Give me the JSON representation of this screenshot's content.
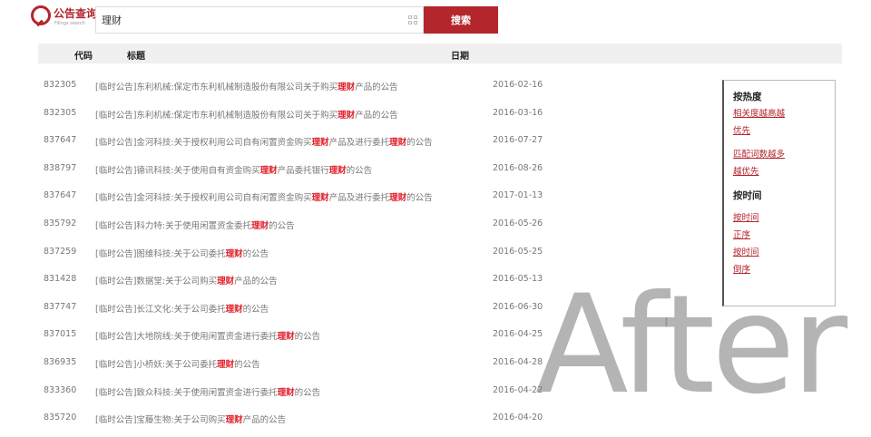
{
  "logo": {
    "text": "公告查询",
    "sub": "Filings search"
  },
  "search": {
    "value": "理财",
    "button_label": "搜索"
  },
  "table": {
    "headers": {
      "code": "代码",
      "title": "标题",
      "date": "日期"
    },
    "rows": [
      {
        "code": "832305",
        "pre": "[临时公告]东利机械:保定市东利机械制造股份有限公司关于购买",
        "hl1": "理财",
        "mid": "产品的公告",
        "hl2": "",
        "post": "",
        "date": "2016-02-16"
      },
      {
        "code": "832305",
        "pre": "[临时公告]东利机械:保定市东利机械制造股份有限公司关于购买",
        "hl1": "理财",
        "mid": "产品的公告",
        "hl2": "",
        "post": "",
        "date": "2016-03-16"
      },
      {
        "code": "837647",
        "pre": "[临时公告]金河科技:关于授权利用公司自有闲置资金购买",
        "hl1": "理财",
        "mid": "产品及进行委托",
        "hl2": "理财",
        "post": "的公告",
        "date": "2016-07-27"
      },
      {
        "code": "838797",
        "pre": "[临时公告]德讯科技:关于使用自有资金购买",
        "hl1": "理财",
        "mid": "产品委托银行",
        "hl2": "理财",
        "post": "的公告",
        "date": "2016-08-26"
      },
      {
        "code": "837647",
        "pre": "[临时公告]金河科技:关于授权利用公司自有闲置资金购买",
        "hl1": "理财",
        "mid": "产品及进行委托",
        "hl2": "理财",
        "post": "的公告",
        "date": "2017-01-13"
      },
      {
        "code": "835792",
        "pre": "[临时公告]科力特:关于使用闲置资金委托",
        "hl1": "理财",
        "mid": "的公告",
        "hl2": "",
        "post": "",
        "date": "2016-05-26"
      },
      {
        "code": "837259",
        "pre": "[临时公告]图维科技:关于公司委托",
        "hl1": "理财",
        "mid": "的公告",
        "hl2": "",
        "post": "",
        "date": "2016-05-25"
      },
      {
        "code": "831428",
        "pre": "[临时公告]数据堂:关于公司购买",
        "hl1": "理财",
        "mid": "产品的公告",
        "hl2": "",
        "post": "",
        "date": "2016-05-13"
      },
      {
        "code": "837747",
        "pre": "[临时公告]长江文化:关于公司委托",
        "hl1": "理财",
        "mid": "的公告",
        "hl2": "",
        "post": "",
        "date": "2016-06-30"
      },
      {
        "code": "837015",
        "pre": "[临时公告]大地院线:关于使用闲置资金进行委托",
        "hl1": "理财",
        "mid": "的公告",
        "hl2": "",
        "post": "",
        "date": "2016-04-25"
      },
      {
        "code": "836935",
        "pre": "[临时公告]小桥妖:关于公司委托",
        "hl1": "理财",
        "mid": "的公告",
        "hl2": "",
        "post": "",
        "date": "2016-04-28"
      },
      {
        "code": "833360",
        "pre": "[临时公告]致众科技:关于使用闲置资金进行委托",
        "hl1": "理财",
        "mid": "的公告",
        "hl2": "",
        "post": "",
        "date": "2016-04-22"
      },
      {
        "code": "835720",
        "pre": "[临时公告]宝藤生物:关于公司购买",
        "hl1": "理财",
        "mid": "产品的公告",
        "hl2": "",
        "post": "",
        "date": "2016-04-20"
      }
    ]
  },
  "sidebar": {
    "heat_heading": "按热度",
    "heat_link1a": "相关度越高越",
    "heat_link1b": "优先",
    "heat_link2a": "匹配词数越多",
    "heat_link2b": "越优先",
    "time_heading": "按时间",
    "time_link1a": "按时间",
    "time_link1b": "正序",
    "time_link2a": "按时间",
    "time_link2b": "倒序"
  },
  "watermark": "After",
  "colors": {
    "accent": "#b3262c",
    "highlight": "#e0202a"
  }
}
